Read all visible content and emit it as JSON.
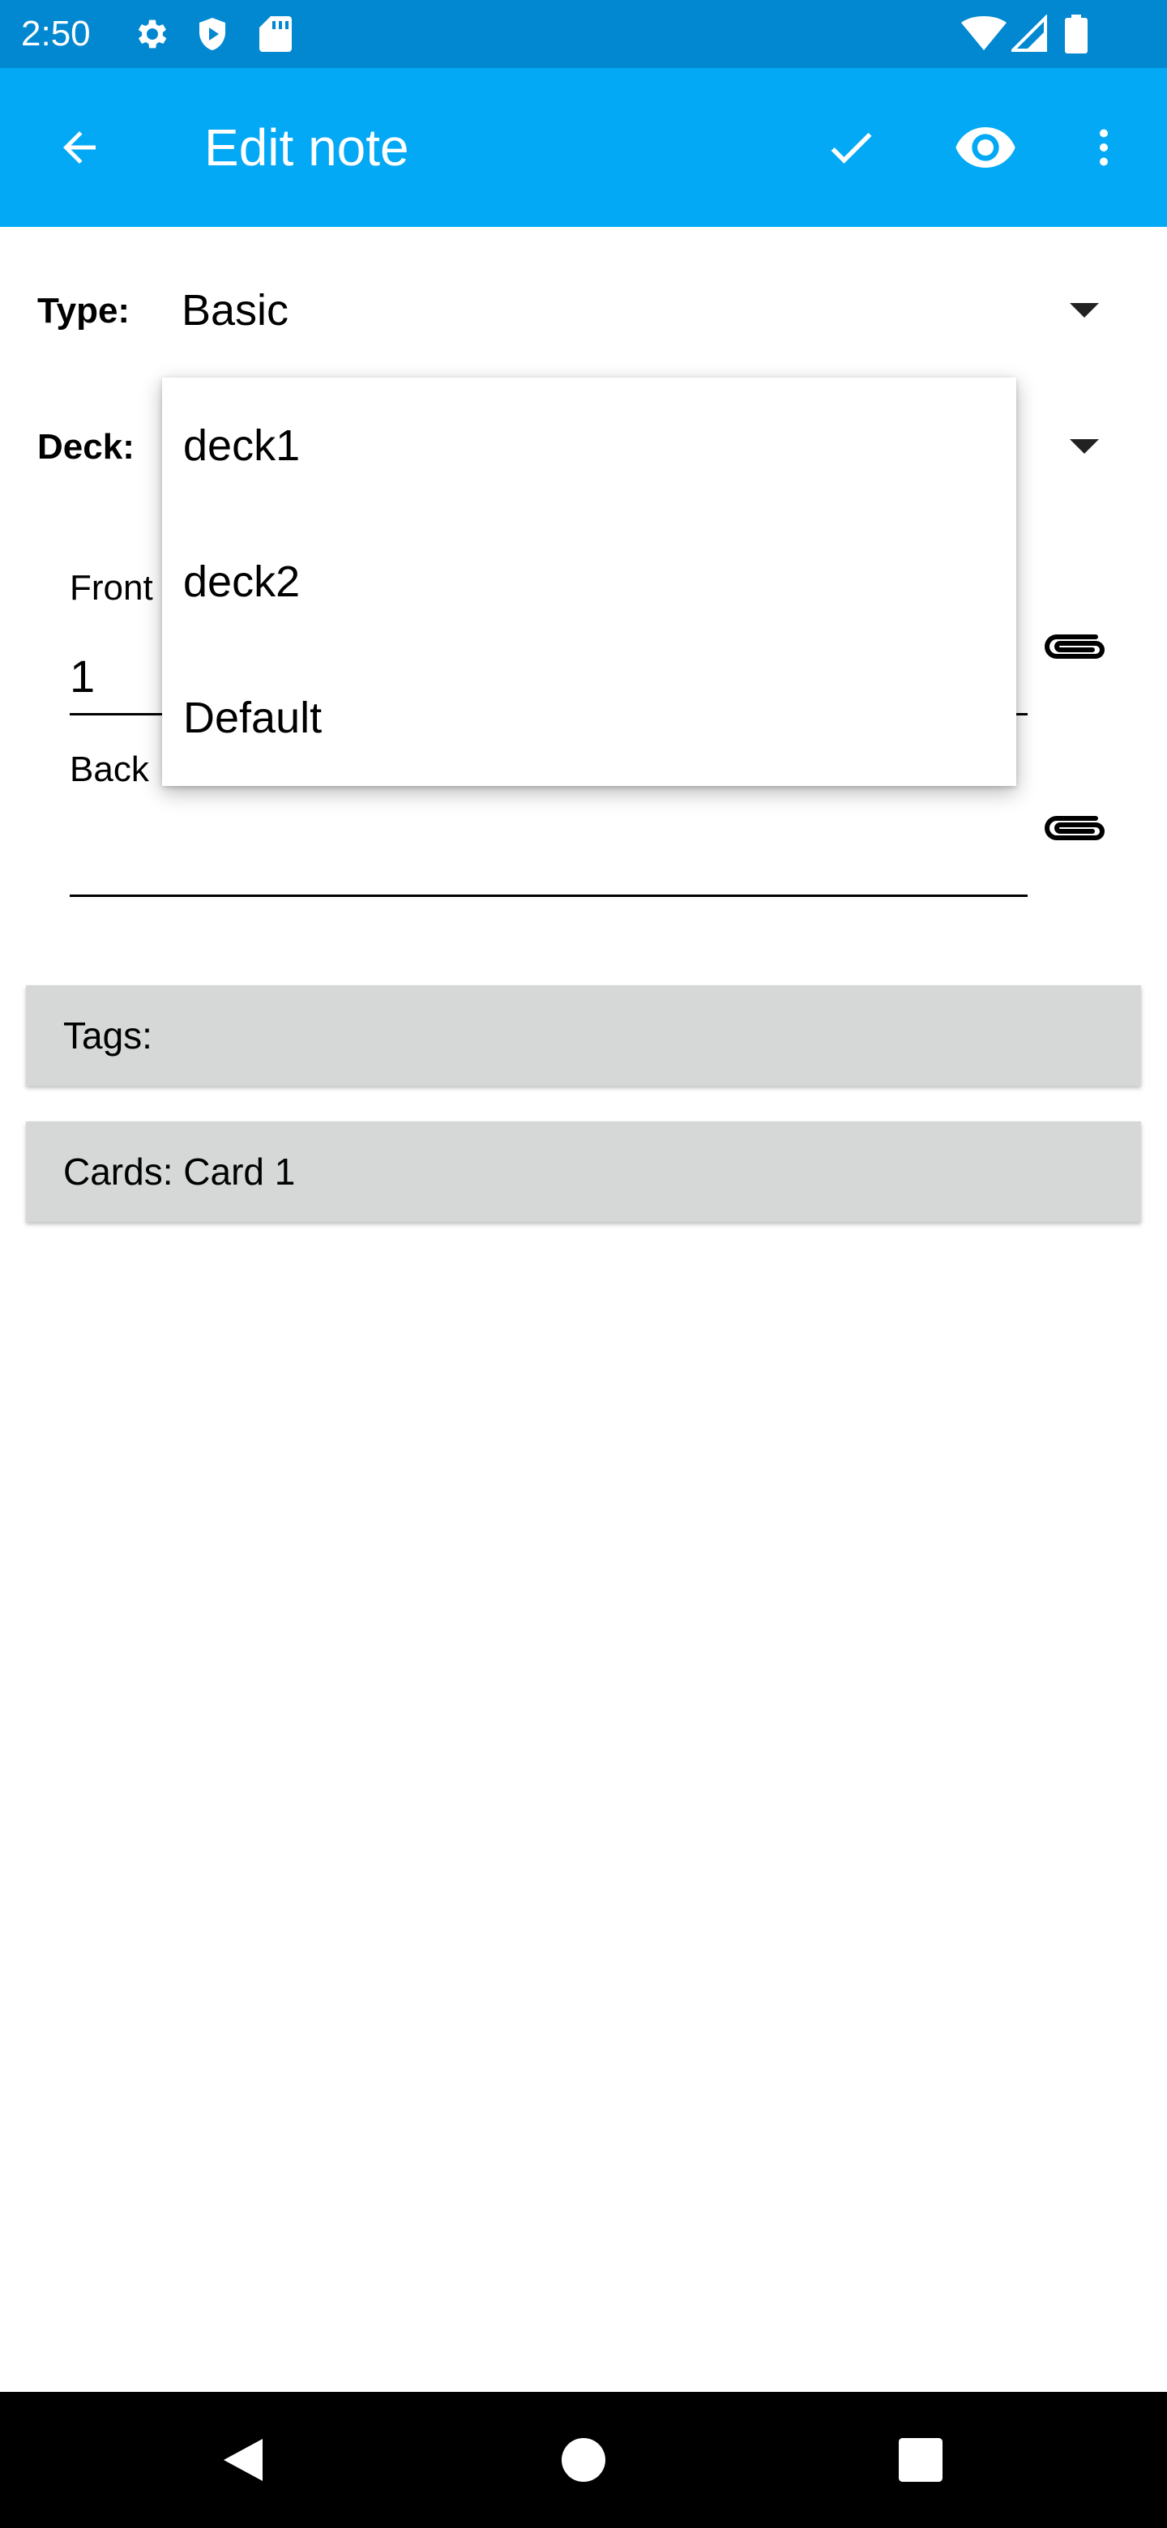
{
  "status_bar": {
    "time": "2:50",
    "icons": [
      "gear-icon",
      "shield-icon",
      "sd-card-icon",
      "wifi-icon",
      "signal-icon",
      "battery-icon"
    ]
  },
  "app_bar": {
    "title": "Edit note",
    "back_icon": "arrow-back-icon",
    "save_icon": "check-icon",
    "preview_icon": "eye-icon",
    "menu_icon": "more-vert-icon",
    "color": "#03a9f4",
    "status_color": "#0288d1"
  },
  "form": {
    "type_label": "Type:",
    "type_value": "Basic",
    "deck_label": "Deck:",
    "fields": [
      {
        "label": "Front",
        "value": "1"
      },
      {
        "label": "Back",
        "value": ""
      }
    ],
    "tags_label": "Tags:",
    "cards_label": "Cards: Card 1"
  },
  "deck_dropdown": {
    "options": [
      "deck1",
      "deck2",
      "Default"
    ]
  },
  "nav_bar": {
    "back_icon": "nav-back-icon",
    "home_icon": "nav-home-icon",
    "recents_icon": "nav-recents-icon"
  }
}
